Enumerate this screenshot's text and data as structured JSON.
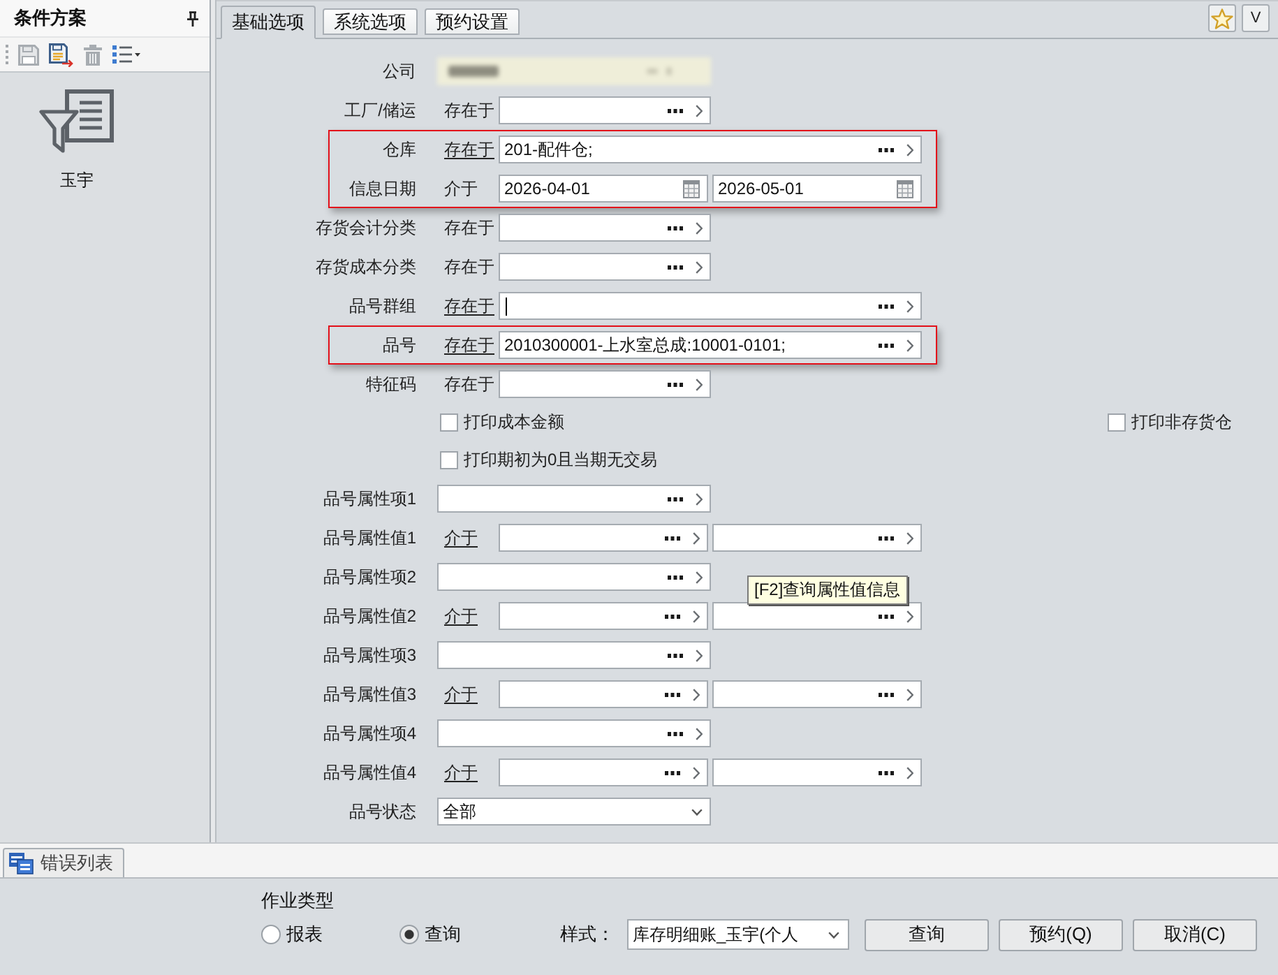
{
  "scheme_panel": {
    "title": "条件方案",
    "toolbar": [
      {
        "kind": "save",
        "disabled": true
      },
      {
        "kind": "save_as",
        "disabled": false
      },
      {
        "kind": "delete",
        "disabled": true
      },
      {
        "kind": "list",
        "disabled": false
      }
    ],
    "schemes": [
      {
        "label": "玉宇"
      }
    ]
  },
  "tabs": [
    {
      "label": "基础选项",
      "selected": true
    },
    {
      "label": "系统选项",
      "selected": false
    },
    {
      "label": "预约设置",
      "selected": false
    }
  ],
  "corner_buttons": [
    {
      "kind": "star"
    },
    {
      "kind": "text",
      "label": "V"
    }
  ],
  "condition_groups": [
    {
      "highlighted": false,
      "rows": [
        {
          "kind": "blurred",
          "label": "公司"
        },
        {
          "kind": "lookup",
          "label": "工厂/储运",
          "operator": "存在于",
          "underlined": false,
          "focused": false
        }
      ]
    },
    {
      "highlighted": true,
      "rows": [
        {
          "kind": "wide_lookup",
          "label": "仓库",
          "operator": "存在于",
          "underlined": true,
          "focused": false,
          "value": "201-配件仓;"
        },
        {
          "kind": "date_range",
          "label": "信息日期",
          "operator": "介于",
          "underlined": false,
          "from": "2026-04-01",
          "to": "2026-05-01"
        }
      ]
    },
    {
      "highlighted": false,
      "rows": [
        {
          "kind": "lookup",
          "label": "存货会计分类",
          "operator": "存在于",
          "underlined": false,
          "focused": false
        },
        {
          "kind": "lookup",
          "label": "存货成本分类",
          "operator": "存在于",
          "underlined": false,
          "focused": false
        },
        {
          "kind": "wide_lookup",
          "label": "品号群组",
          "operator": "存在于",
          "underlined": true,
          "focused": true
        }
      ]
    },
    {
      "highlighted": true,
      "rows": [
        {
          "kind": "wide_lookup",
          "label": "品号",
          "operator": "存在于",
          "underlined": true,
          "focused": false,
          "value": "2010300001-上水室总成:10001-0101;"
        }
      ]
    },
    {
      "highlighted": false,
      "rows": [
        {
          "kind": "lookup",
          "label": "特征码",
          "operator": "存在于",
          "underlined": false,
          "focused": false
        },
        {
          "kind": "checkboxes",
          "items": [
            {
              "label": "打印成本金额",
              "checked": false
            },
            {
              "label": "打印非存货仓",
              "checked": false
            }
          ]
        },
        {
          "kind": "checkboxes",
          "items": [
            {
              "label": "打印期初为0且当期无交易",
              "checked": false
            }
          ]
        },
        {
          "kind": "attribute",
          "label": "品号属性项1"
        },
        {
          "kind": "value_range",
          "label": "品号属性值1",
          "operator": "介于",
          "underlined": true
        },
        {
          "kind": "attribute",
          "label": "品号属性项2",
          "tooltip": "[F2]查询属性值信息"
        },
        {
          "kind": "value_range",
          "label": "品号属性值2",
          "operator": "介于",
          "underlined": true
        },
        {
          "kind": "attribute",
          "label": "品号属性项3"
        },
        {
          "kind": "value_range",
          "label": "品号属性值3",
          "operator": "介于",
          "underlined": true
        },
        {
          "kind": "attribute",
          "label": "品号属性项4"
        },
        {
          "kind": "value_range",
          "label": "品号属性值4",
          "operator": "介于",
          "underlined": true
        },
        {
          "kind": "select",
          "label": "品号状态",
          "value": "全部"
        }
      ]
    }
  ],
  "bottom_tabs": [
    {
      "label": "错误列表"
    }
  ],
  "job_type": {
    "title": "作业类型",
    "options": [
      {
        "label": "报表",
        "selected": false
      },
      {
        "label": "查询",
        "selected": true
      }
    ]
  },
  "style": {
    "label": "样式：",
    "value": "库存明细账_玉宇(个人"
  },
  "buttons": [
    {
      "label": "查询"
    },
    {
      "label": "预约(Q)"
    },
    {
      "label": "取消(C)"
    }
  ]
}
